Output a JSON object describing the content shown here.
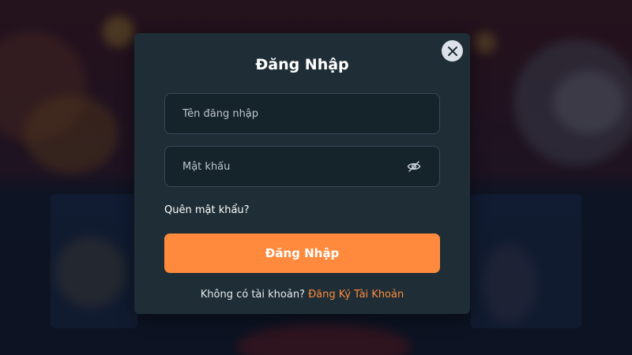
{
  "modal": {
    "title": "Đăng Nhập",
    "close_icon": "close-icon",
    "username": {
      "placeholder": "Tên đăng nhập",
      "value": ""
    },
    "password": {
      "placeholder": "Mật khẩu",
      "value": "",
      "toggle_icon": "eye-off-icon"
    },
    "forgot_label": "Quên mật khẩu?",
    "submit_label": "Đăng Nhập",
    "signup_prompt": "Không có tài khoản?",
    "signup_link": "Đăng Ký Tài Khoản"
  },
  "colors": {
    "accent": "#ff8a3d",
    "modal_bg": "#1f2e36",
    "field_bg": "#15232b",
    "field_border": "#394a54"
  }
}
